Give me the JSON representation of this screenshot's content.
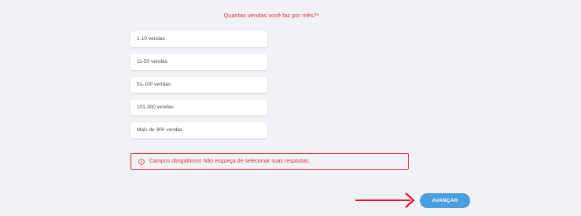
{
  "question": "Quantas vendas você faz por mês?*",
  "options": [
    {
      "label": "1-10 vendas"
    },
    {
      "label": "11-50 vendas"
    },
    {
      "label": "51-100 vendas"
    },
    {
      "label": "101-300 vendas"
    },
    {
      "label": "Mais de 300 vendas"
    }
  ],
  "error": {
    "icon": "error-circle-icon",
    "message": "Campos obrigatórios! Não esqueça de selecionar suas respostas."
  },
  "submit_label": "AVANÇAR",
  "annotation": {
    "icon": "red-arrow-icon",
    "color": "#e8161c"
  },
  "colors": {
    "error": "#e0303e",
    "button": "#4a9fdc",
    "background": "#f1f2f5"
  }
}
